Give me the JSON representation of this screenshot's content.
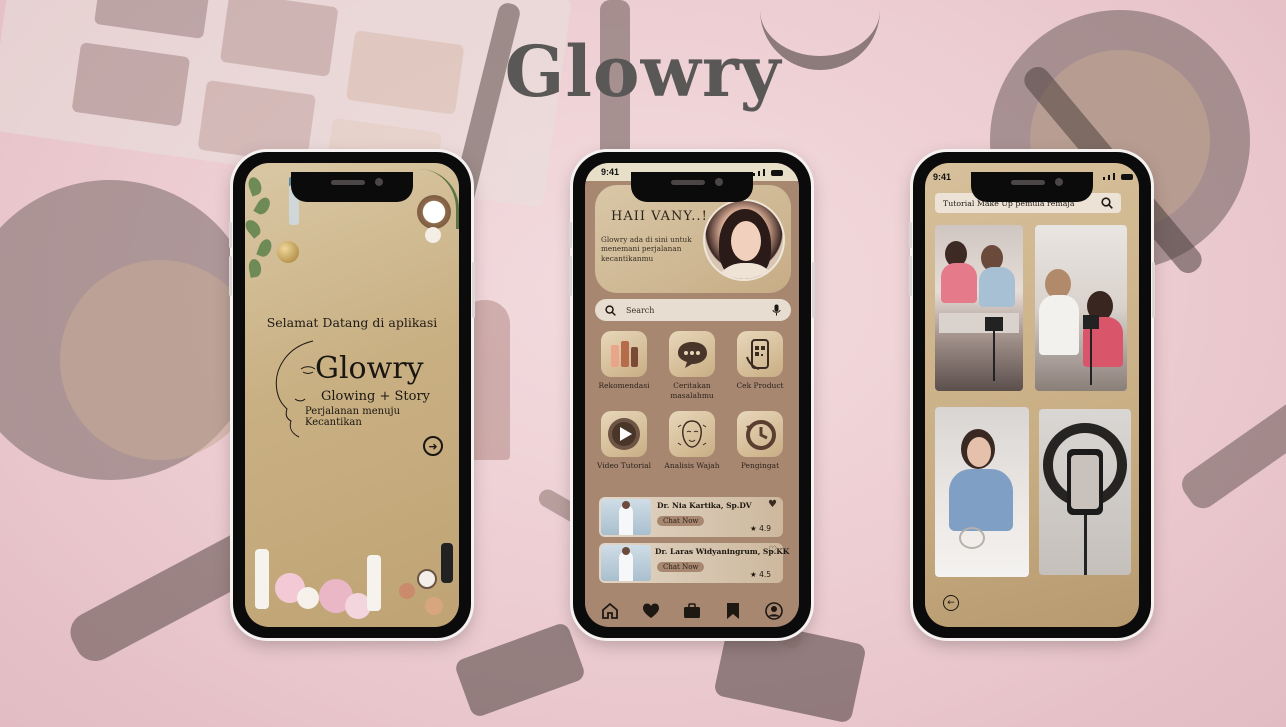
{
  "brand": {
    "title": "Glowry"
  },
  "phone1": {
    "welcome": "Selamat Datang di aplikasi",
    "logo": "Glowry",
    "subtitle": "Glowing + Story",
    "tagline": "Perjalanan menuju Kecantikan",
    "next_icon": "arrow-right-circle-icon"
  },
  "phone2": {
    "status_time": "9:41",
    "greeting": "HAII VANY..!",
    "greeting_text": "Glowry ada di sini untuk menemani perjalanan kecantikanmu",
    "search": {
      "placeholder": "Search"
    },
    "menu": [
      {
        "label": "Rekomendasi",
        "icon": "products-icon"
      },
      {
        "label": "Ceritakan masalahmu",
        "icon": "chat-bubble-icon"
      },
      {
        "label": "Cek Product",
        "icon": "qr-scan-icon"
      },
      {
        "label": "Video Tutorial",
        "icon": "play-icon"
      },
      {
        "label": "Analisis Wajah",
        "icon": "face-analysis-icon"
      },
      {
        "label": "Pengingat",
        "icon": "clock-reminder-icon"
      }
    ],
    "doctors": [
      {
        "name": "Dr. Nia Kartika, Sp.DV",
        "chat": "Chat Now",
        "rating": "4.9",
        "favorited": true
      },
      {
        "name": "Dr. Laras Widyaningrum, Sp.KK",
        "chat": "Chat Now",
        "rating": "4.5",
        "favorited": false
      }
    ],
    "nav": [
      "home-icon",
      "heart-icon",
      "briefcase-icon",
      "bookmark-icon",
      "profile-icon"
    ]
  },
  "phone3": {
    "status_time": "9:41",
    "search_query": "Tutorial Make Up pemula remaja",
    "back_icon": "arrow-left-circle-icon"
  }
}
